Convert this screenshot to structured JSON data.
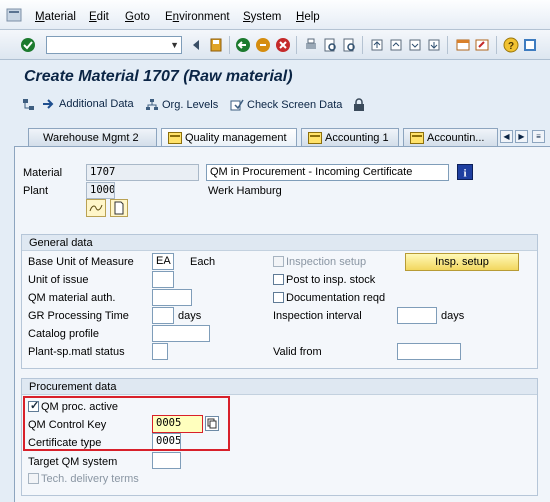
{
  "menu": {
    "items": [
      {
        "label": "Material",
        "u": "M"
      },
      {
        "label": "Edit",
        "u": "E"
      },
      {
        "label": "Goto",
        "u": "G"
      },
      {
        "label": "Environment",
        "u": "n"
      },
      {
        "label": "System",
        "u": "S"
      },
      {
        "label": "Help",
        "u": "H"
      }
    ]
  },
  "toolbar": {
    "command_field_value": ""
  },
  "title": "Create Material 1707 (Raw material)",
  "app_toolbar": {
    "additional_data": "Additional Data",
    "org_levels": "Org. Levels",
    "check_screen_data": "Check Screen Data"
  },
  "tabs": [
    {
      "label": "Warehouse Mgmt 2",
      "active": false
    },
    {
      "label": "Quality management",
      "active": true
    },
    {
      "label": "Accounting 1",
      "active": false
    },
    {
      "label": "Accountin...",
      "active": false
    }
  ],
  "header": {
    "material_label": "Material",
    "material_value": "1707",
    "material_desc": "QM in Procurement - Incoming Certificate",
    "plant_label": "Plant",
    "plant_value": "1000",
    "plant_desc": "Werk Hamburg"
  },
  "general_data": {
    "title": "General data",
    "base_uom_label": "Base Unit of Measure",
    "base_uom_value": "EA",
    "base_uom_text": "Each",
    "unit_of_issue_label": "Unit of issue",
    "qm_material_auth_label": "QM material auth.",
    "gr_processing_time_label": "GR Processing Time",
    "gr_days": "days",
    "catalog_profile_label": "Catalog profile",
    "plant_sp_status_label": "Plant-sp.matl status",
    "inspection_setup_label": "Inspection setup",
    "insp_setup_button": "Insp. setup",
    "post_to_insp_stock_label": "Post to insp. stock",
    "documentation_reqd_label": "Documentation reqd",
    "inspection_interval_label": "Inspection interval",
    "insp_days": "days",
    "valid_from_label": "Valid from"
  },
  "procurement_data": {
    "title": "Procurement data",
    "qm_proc_active_label": "QM proc. active",
    "qm_proc_active_checked": true,
    "qm_control_key_label": "QM Control Key",
    "qm_control_key_value": "0005",
    "certificate_type_label": "Certificate type",
    "certificate_type_value": "0005",
    "target_qm_system_label": "Target QM system",
    "tech_delivery_terms_label": "Tech. delivery terms"
  },
  "colors": {
    "highlight": "#d8202a",
    "title": "#0b2545",
    "button_yellow": "#f2d75f"
  }
}
